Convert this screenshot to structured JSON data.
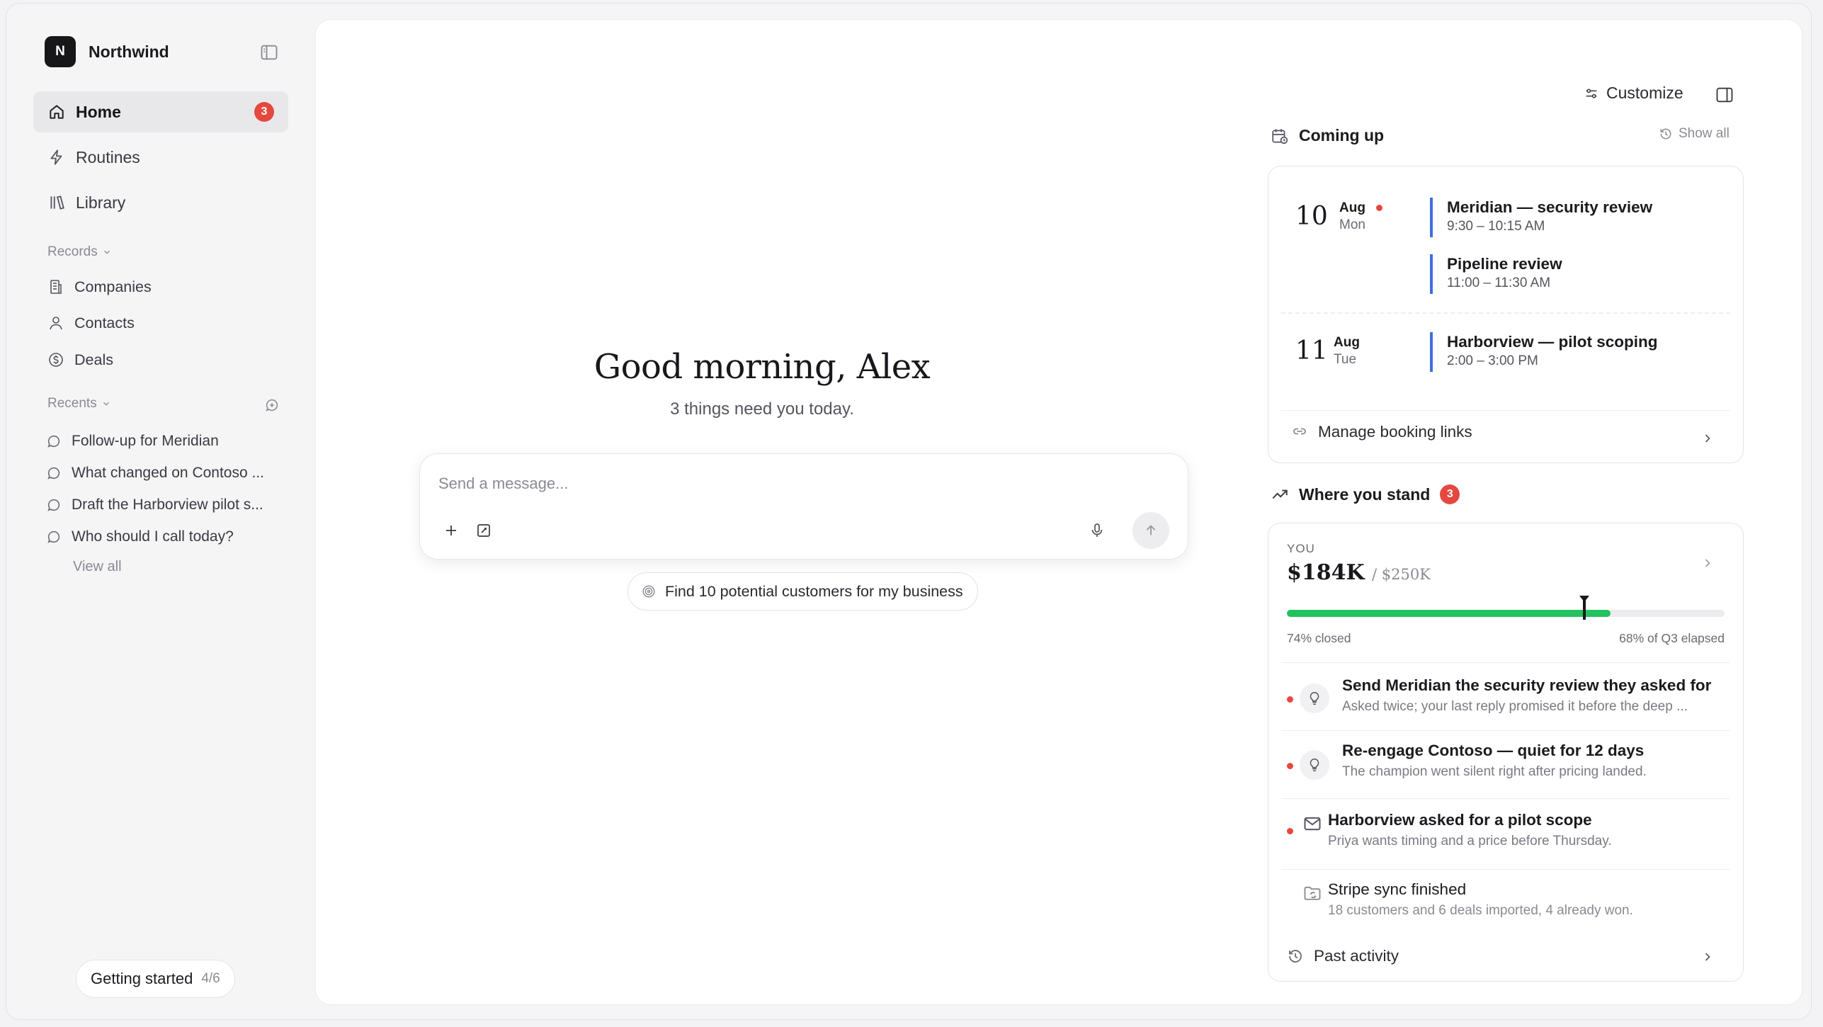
{
  "brand": {
    "logo_letter": "N",
    "name": "Northwind"
  },
  "nav": [
    {
      "label": "Home",
      "icon": "home-icon",
      "badge": "3",
      "active": true
    },
    {
      "label": "Routines",
      "icon": "bolt-icon"
    },
    {
      "label": "Library",
      "icon": "library-icon"
    }
  ],
  "records": {
    "label": "Records",
    "items": [
      {
        "label": "Companies",
        "icon": "building-icon"
      },
      {
        "label": "Contacts",
        "icon": "person-icon"
      },
      {
        "label": "Deals",
        "icon": "dollar-icon"
      }
    ]
  },
  "recents": {
    "label": "Recents",
    "items": [
      "Follow-up for Meridian",
      "What changed on Contoso ...",
      "Draft the Harborview pilot s...",
      "Who should I call today?"
    ],
    "view_all": "View all"
  },
  "getting_started": {
    "label": "Getting started",
    "count": "4/6"
  },
  "main": {
    "greeting": "Good morning, Alex",
    "subgreeting": "3 things need you today.",
    "composer_placeholder": "Send a message...",
    "suggestion": "Find 10 potential customers for my business"
  },
  "right": {
    "customize": "Customize",
    "coming_up": {
      "title": "Coming up",
      "show_all": "Show all",
      "days": [
        {
          "num": "10",
          "month": "Aug",
          "dow": "Mon",
          "has_dot": true,
          "events": [
            {
              "title": "Meridian — security review",
              "time": "9:30 – 10:15 AM"
            },
            {
              "title": "Pipeline review",
              "time": "11:00 – 11:30 AM"
            }
          ]
        },
        {
          "num": "11",
          "month": "Aug",
          "dow": "Tue",
          "has_dot": false,
          "events": [
            {
              "title": "Harborview — pilot scoping",
              "time": "2:00 – 3:00 PM"
            }
          ]
        }
      ],
      "manage_link": "Manage booking links"
    },
    "where_you_stand": {
      "title": "Where you stand",
      "badge": "3",
      "you_label": "YOU",
      "amount": "$184K",
      "target": "/ $250K",
      "progress_fraction": 0.74,
      "elapsed_fraction": 0.68,
      "closed_label": "74% closed",
      "elapsed_label": "68% of Q3 elapsed",
      "colors": {
        "progress": "#22c35e",
        "alert": "#e5483f",
        "event_bar": "#3d6fe0"
      },
      "activities": [
        {
          "title": "Send Meridian the security review they asked for",
          "desc": "Asked twice; your last reply promised it before the deep ...",
          "icon": "lightbulb-icon",
          "unread": true
        },
        {
          "title": "Re-engage Contoso — quiet for 12 days",
          "desc": "The champion went silent right after pricing landed.",
          "icon": "lightbulb-icon",
          "unread": true
        },
        {
          "title": "Harborview asked for a pilot scope",
          "desc": "Priya wants timing and a price before Thursday.",
          "icon": "mail-icon",
          "unread": true
        },
        {
          "title": "Stripe sync finished",
          "desc": "18 customers and 6 deals imported, 4 already won.",
          "icon": "folder-sync-icon",
          "unread": false
        }
      ],
      "past_activity": "Past activity"
    }
  }
}
